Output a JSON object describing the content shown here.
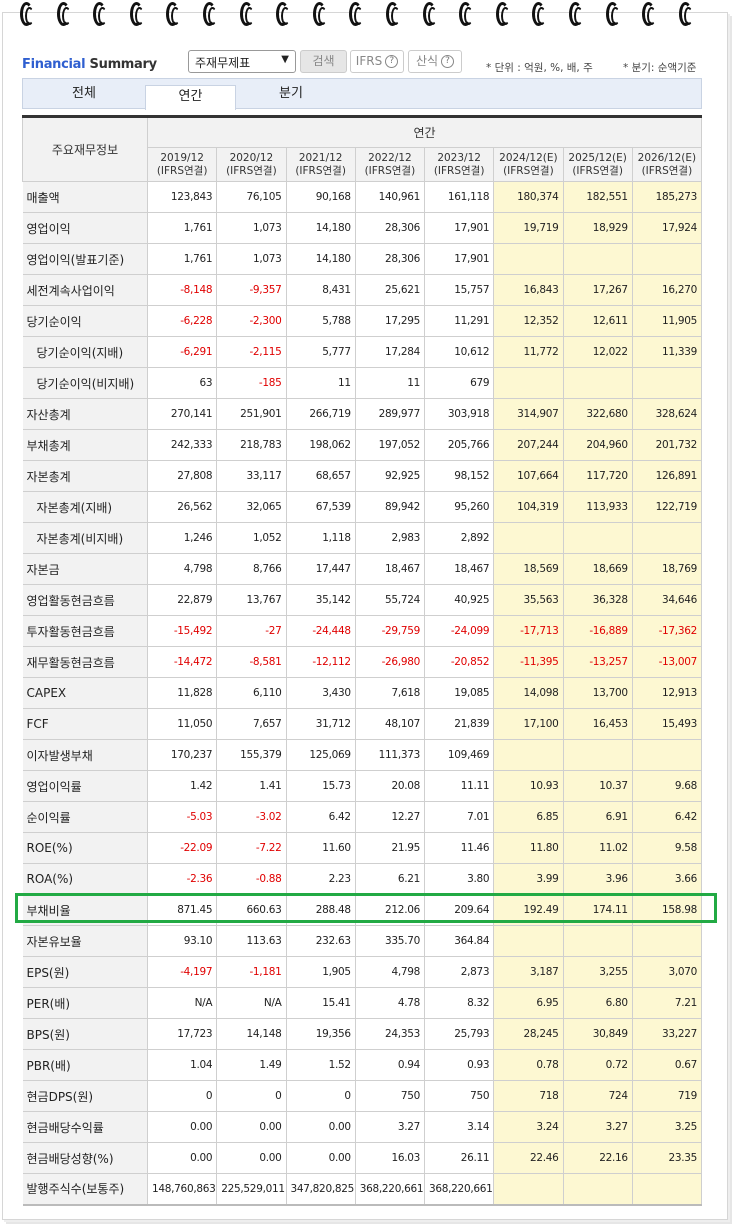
{
  "header": {
    "title_part1": "Financial",
    "title_part2": "Summary",
    "select_value": "주재무제표",
    "search_label": "검색",
    "ifrs_label": "IFRS",
    "formula_label": "산식",
    "unit_note": "* 단위 : 억원, %, 배, 주",
    "quarter_note": "* 분기: 순액기준"
  },
  "tabs": [
    {
      "label": "전체"
    },
    {
      "label": "연간"
    },
    {
      "label": "분기"
    }
  ],
  "table": {
    "corner": "주요재무정보",
    "group": "연간",
    "columns": [
      [
        "2019/12",
        "(IFRS연결)"
      ],
      [
        "2020/12",
        "(IFRS연결)"
      ],
      [
        "2021/12",
        "(IFRS연결)"
      ],
      [
        "2022/12",
        "(IFRS연결)"
      ],
      [
        "2023/12",
        "(IFRS연결)"
      ],
      [
        "2024/12(E)",
        "(IFRS연결)"
      ],
      [
        "2025/12(E)",
        "(IFRS연결)"
      ],
      [
        "2026/12(E)",
        "(IFRS연결)"
      ]
    ],
    "rows": [
      {
        "label": "매출액",
        "values": [
          "123,843",
          "76,105",
          "90,168",
          "140,961",
          "161,118",
          "180,374",
          "182,551",
          "185,273"
        ]
      },
      {
        "label": "영업이익",
        "values": [
          "1,761",
          "1,073",
          "14,180",
          "28,306",
          "17,901",
          "19,719",
          "18,929",
          "17,924"
        ]
      },
      {
        "label": "영업이익(발표기준)",
        "values": [
          "1,761",
          "1,073",
          "14,180",
          "28,306",
          "17,901",
          "",
          "",
          ""
        ]
      },
      {
        "label": "세전계속사업이익",
        "values": [
          "-8,148",
          "-9,357",
          "8,431",
          "25,621",
          "15,757",
          "16,843",
          "17,267",
          "16,270"
        ]
      },
      {
        "label": "당기순이익",
        "values": [
          "-6,228",
          "-2,300",
          "5,788",
          "17,295",
          "11,291",
          "12,352",
          "12,611",
          "11,905"
        ]
      },
      {
        "label": "당기순이익(지배)",
        "indent": true,
        "values": [
          "-6,291",
          "-2,115",
          "5,777",
          "17,284",
          "10,612",
          "11,772",
          "12,022",
          "11,339"
        ]
      },
      {
        "label": "당기순이익(비지배)",
        "indent": true,
        "values": [
          "63",
          "-185",
          "11",
          "11",
          "679",
          "",
          "",
          ""
        ]
      },
      {
        "label": "자산총계",
        "values": [
          "270,141",
          "251,901",
          "266,719",
          "289,977",
          "303,918",
          "314,907",
          "322,680",
          "328,624"
        ]
      },
      {
        "label": "부채총계",
        "values": [
          "242,333",
          "218,783",
          "198,062",
          "197,052",
          "205,766",
          "207,244",
          "204,960",
          "201,732"
        ]
      },
      {
        "label": "자본총계",
        "values": [
          "27,808",
          "33,117",
          "68,657",
          "92,925",
          "98,152",
          "107,664",
          "117,720",
          "126,891"
        ]
      },
      {
        "label": "자본총계(지배)",
        "indent": true,
        "values": [
          "26,562",
          "32,065",
          "67,539",
          "89,942",
          "95,260",
          "104,319",
          "113,933",
          "122,719"
        ]
      },
      {
        "label": "자본총계(비지배)",
        "indent": true,
        "values": [
          "1,246",
          "1,052",
          "1,118",
          "2,983",
          "2,892",
          "",
          "",
          ""
        ]
      },
      {
        "label": "자본금",
        "values": [
          "4,798",
          "8,766",
          "17,447",
          "18,467",
          "18,467",
          "18,569",
          "18,669",
          "18,769"
        ]
      },
      {
        "label": "영업활동현금흐름",
        "values": [
          "22,879",
          "13,767",
          "35,142",
          "55,724",
          "40,925",
          "35,563",
          "36,328",
          "34,646"
        ]
      },
      {
        "label": "투자활동현금흐름",
        "values": [
          "-15,492",
          "-27",
          "-24,448",
          "-29,759",
          "-24,099",
          "-17,713",
          "-16,889",
          "-17,362"
        ]
      },
      {
        "label": "재무활동현금흐름",
        "values": [
          "-14,472",
          "-8,581",
          "-12,112",
          "-26,980",
          "-20,852",
          "-11,395",
          "-13,257",
          "-13,007"
        ]
      },
      {
        "label": "CAPEX",
        "values": [
          "11,828",
          "6,110",
          "3,430",
          "7,618",
          "19,085",
          "14,098",
          "13,700",
          "12,913"
        ]
      },
      {
        "label": "FCF",
        "values": [
          "11,050",
          "7,657",
          "31,712",
          "48,107",
          "21,839",
          "17,100",
          "16,453",
          "15,493"
        ]
      },
      {
        "label": "이자발생부채",
        "values": [
          "170,237",
          "155,379",
          "125,069",
          "111,373",
          "109,469",
          "",
          "",
          ""
        ]
      },
      {
        "label": "영업이익률",
        "values": [
          "1.42",
          "1.41",
          "15.73",
          "20.08",
          "11.11",
          "10.93",
          "10.37",
          "9.68"
        ]
      },
      {
        "label": "순이익률",
        "values": [
          "-5.03",
          "-3.02",
          "6.42",
          "12.27",
          "7.01",
          "6.85",
          "6.91",
          "6.42"
        ]
      },
      {
        "label": "ROE(%)",
        "values": [
          "-22.09",
          "-7.22",
          "11.60",
          "21.95",
          "11.46",
          "11.80",
          "11.02",
          "9.58"
        ]
      },
      {
        "label": "ROA(%)",
        "values": [
          "-2.36",
          "-0.88",
          "2.23",
          "6.21",
          "3.80",
          "3.99",
          "3.96",
          "3.66"
        ]
      },
      {
        "label": "부채비율",
        "highlight": true,
        "values": [
          "871.45",
          "660.63",
          "288.48",
          "212.06",
          "209.64",
          "192.49",
          "174.11",
          "158.98"
        ]
      },
      {
        "label": "자본유보율",
        "values": [
          "93.10",
          "113.63",
          "232.63",
          "335.70",
          "364.84",
          "",
          "",
          ""
        ]
      },
      {
        "label": "EPS(원)",
        "values": [
          "-4,197",
          "-1,181",
          "1,905",
          "4,798",
          "2,873",
          "3,187",
          "3,255",
          "3,070"
        ]
      },
      {
        "label": "PER(배)",
        "values": [
          "N/A",
          "N/A",
          "15.41",
          "4.78",
          "8.32",
          "6.95",
          "6.80",
          "7.21"
        ]
      },
      {
        "label": "BPS(원)",
        "values": [
          "17,723",
          "14,148",
          "19,356",
          "24,353",
          "25,793",
          "28,245",
          "30,849",
          "33,227"
        ]
      },
      {
        "label": "PBR(배)",
        "values": [
          "1.04",
          "1.49",
          "1.52",
          "0.94",
          "0.93",
          "0.78",
          "0.72",
          "0.67"
        ]
      },
      {
        "label": "현금DPS(원)",
        "values": [
          "0",
          "0",
          "0",
          "750",
          "750",
          "718",
          "724",
          "719"
        ]
      },
      {
        "label": "현금배당수익률",
        "values": [
          "0.00",
          "0.00",
          "0.00",
          "3.27",
          "3.14",
          "3.24",
          "3.27",
          "3.25"
        ]
      },
      {
        "label": "현금배당성향(%)",
        "values": [
          "0.00",
          "0.00",
          "0.00",
          "16.03",
          "26.11",
          "22.46",
          "22.16",
          "23.35"
        ]
      },
      {
        "label": "발행주식수(보통주)",
        "values": [
          "148,760,863",
          "225,529,011",
          "347,820,825",
          "368,220,661",
          "368,220,661",
          "",
          "",
          ""
        ]
      }
    ]
  },
  "colors": {
    "negative": "#e00000",
    "estimate_bg": "#fdf8d2",
    "highlight": "#22aa44",
    "accent": "#2f5fd0"
  }
}
